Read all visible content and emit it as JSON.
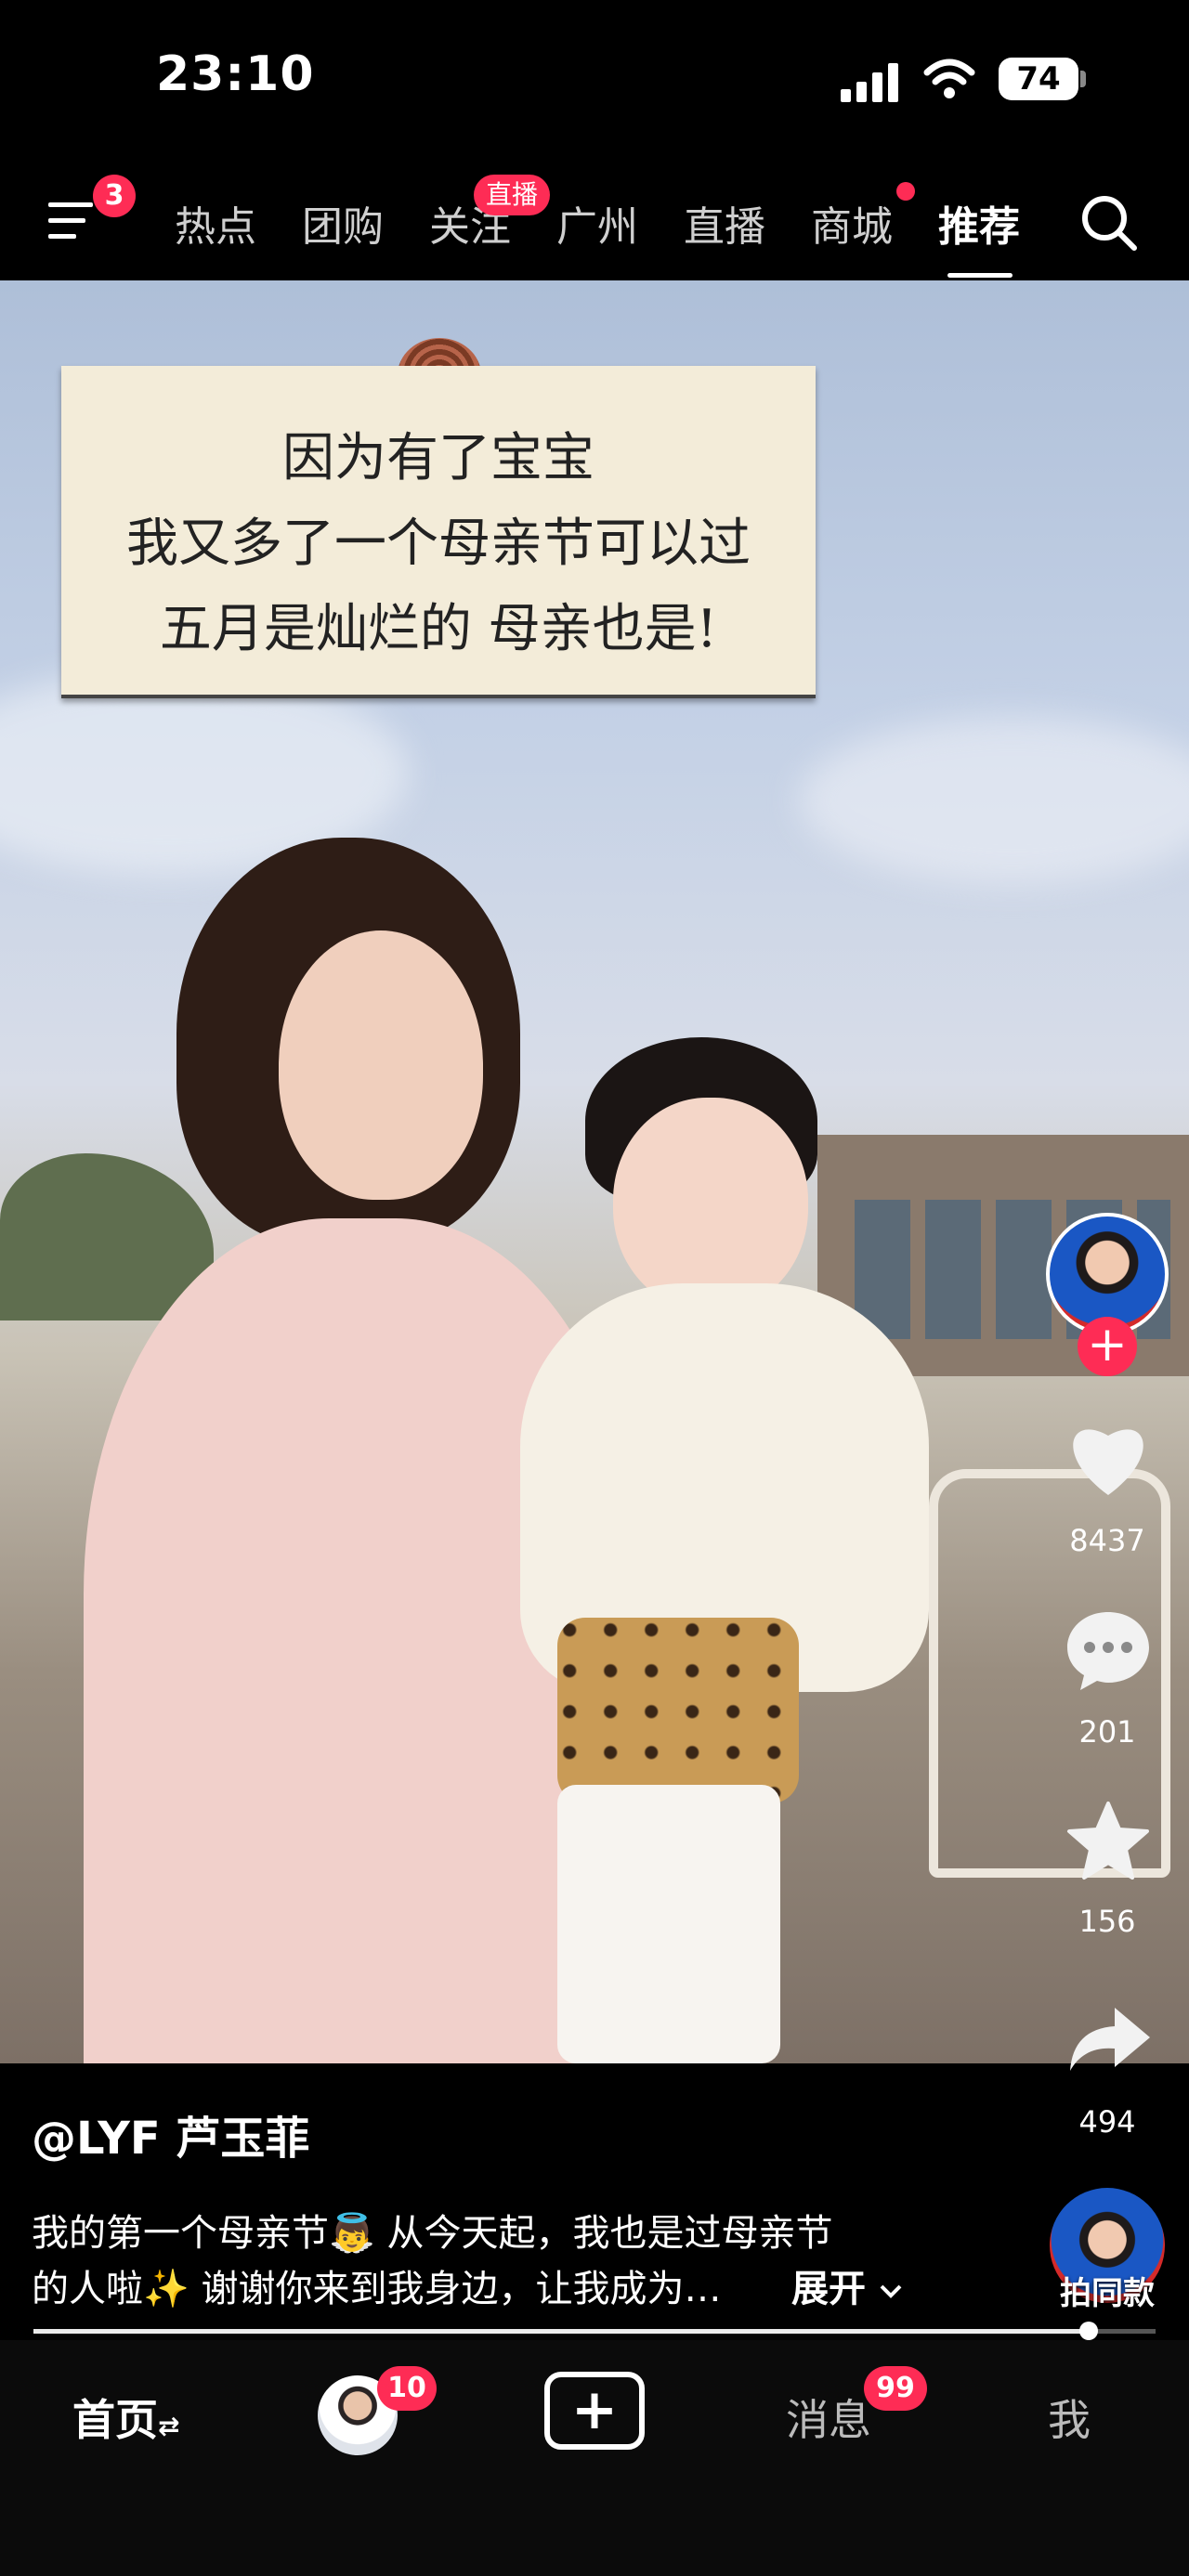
{
  "status_bar": {
    "time": "23:10",
    "battery": "74"
  },
  "top_nav": {
    "menu_badge": "3",
    "tabs": [
      "热点",
      "团购",
      "关注",
      "广州",
      "直播",
      "商城",
      "推荐"
    ],
    "follow_badge": "直播",
    "active_tab": "推荐"
  },
  "video": {
    "note_lines": [
      "因为有了宝宝",
      "我又多了一个母亲节可以过",
      "五月是灿烂的 母亲也是!"
    ]
  },
  "side_actions": {
    "likes": "8437",
    "comments": "201",
    "favorites": "156",
    "shares": "494",
    "same_style_label": "拍同款"
  },
  "caption": {
    "author": "@LYF 芦玉菲",
    "line1": "我的第一个母亲节👼 从今天起，我也是过母亲节",
    "line2": "的人啦✨ 谢谢你来到我身边，让我成为…",
    "expand_label": "展开"
  },
  "progress": {
    "fraction": 0.94
  },
  "bottom_nav": {
    "home": "首页",
    "friends_badge": "10",
    "messages": "消息",
    "messages_badge": "99",
    "me": "我"
  },
  "colors": {
    "accent": "#fe2c55",
    "background": "#000000"
  }
}
